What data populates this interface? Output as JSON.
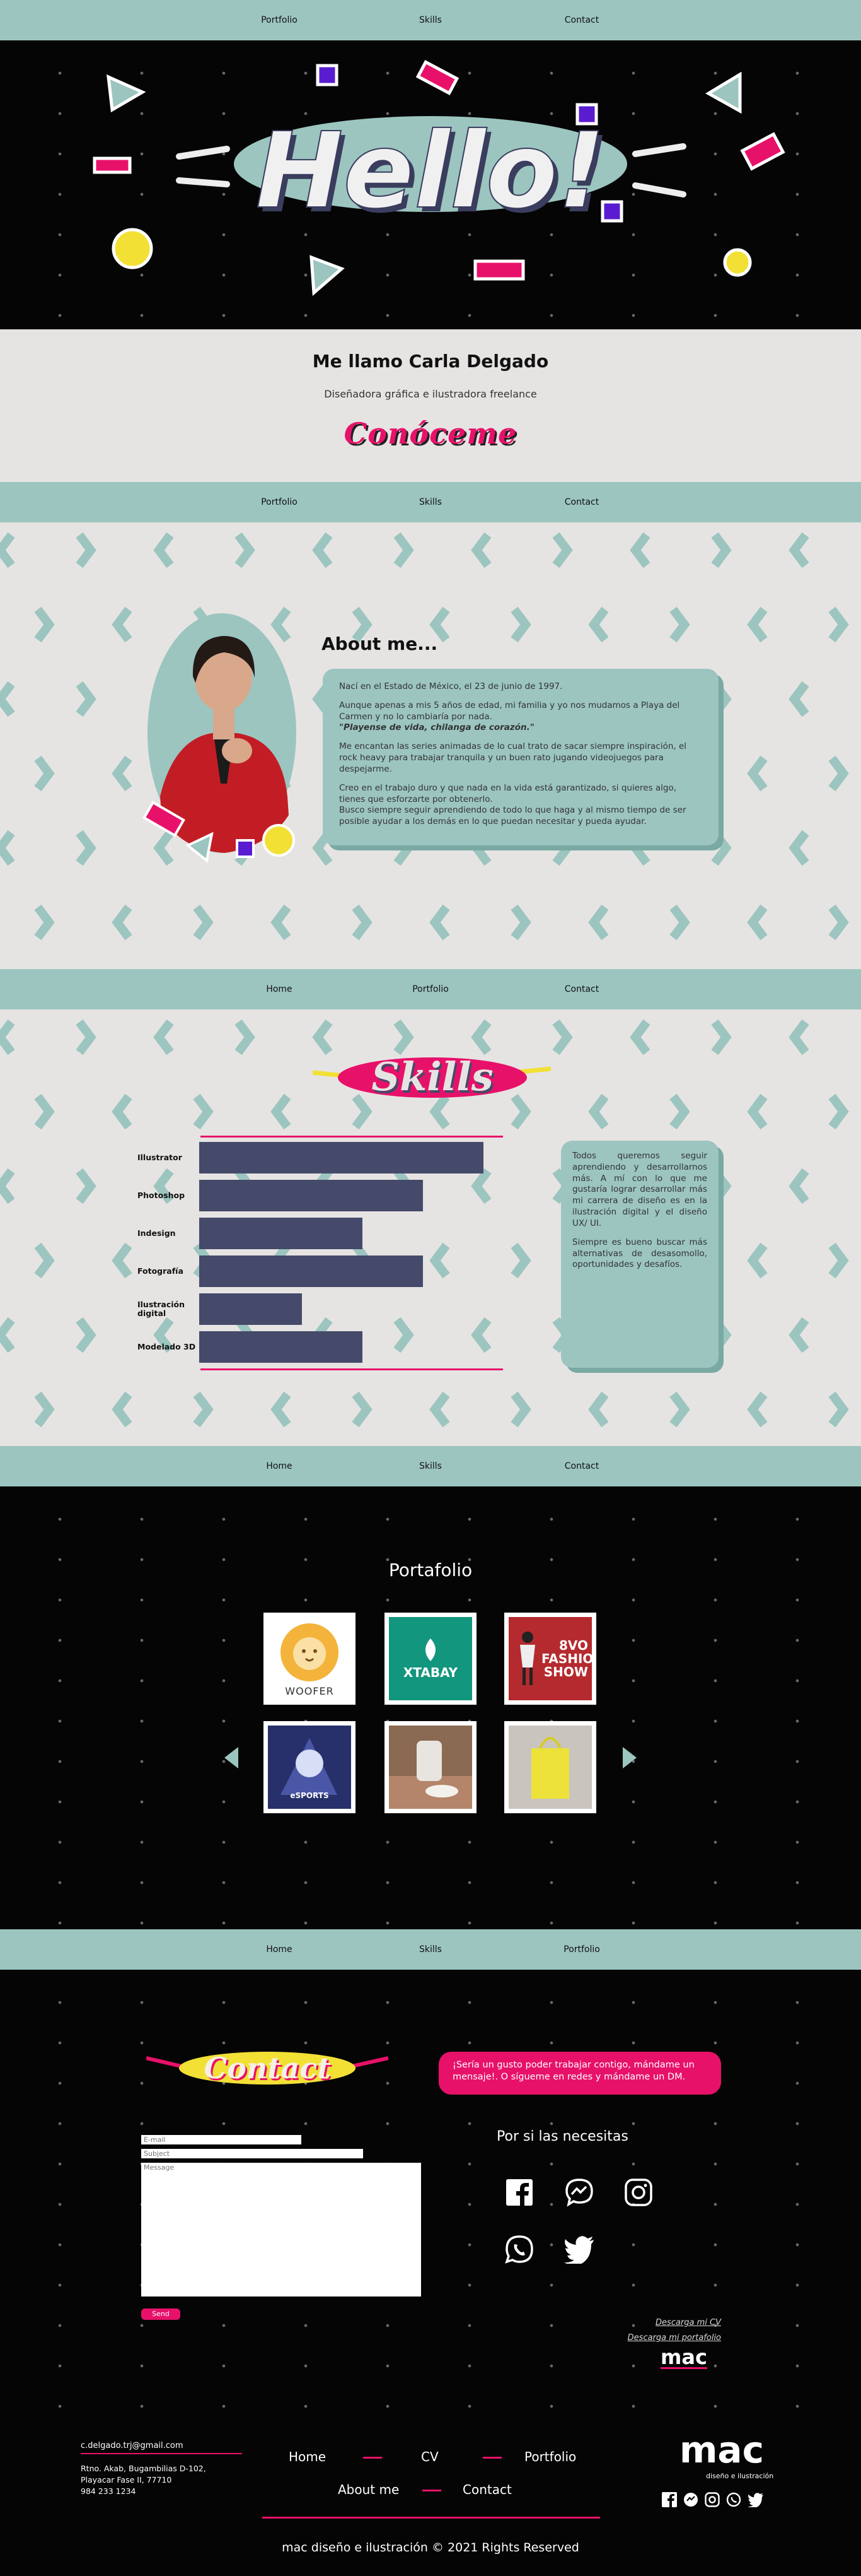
{
  "nav1": [
    "Portfolio",
    "Skills",
    "Contact"
  ],
  "hero": {
    "headline": "Hello!"
  },
  "intro": {
    "name": "Me llamo Carla Delgado",
    "role": "Diseñadora gráfica e ilustradora freelance",
    "cta": "Conóceme"
  },
  "nav2": [
    "Portfolio",
    "Skills",
    "Contact"
  ],
  "about": {
    "title": "About me...",
    "p1": "Nací en el Estado de México, el 23 de junio de 1997.",
    "p2": "Aunque apenas a mis 5 años de edad, mi familia y yo nos mudamos a Playa del Carmen y no lo cambiaría por nada.",
    "p2_quote": "\"Playense de vida, chilanga de corazón.\"",
    "p3": "Me encantan las series animadas de lo cual trato de sacar siempre inspiración, el rock heavy para trabajar tranquila y un buen rato jugando videojuegos para despejarme.",
    "p4": "Creo en el trabajo duro y que nada en la vida está garantizado, si quieres algo, tienes que esforzarte por obtenerlo.",
    "p5": "Busco siempre seguir aprendiendo de todo lo que haga y al mismo tiempo de ser posible ayudar a los demás en lo que puedan necesitar y pueda ayudar."
  },
  "nav3": [
    "Home",
    "Portfolio",
    "Contact"
  ],
  "skills": {
    "title": "Skills",
    "items": [
      {
        "label": "Illustrator",
        "level": 0.94
      },
      {
        "label": "Photoshop",
        "level": 0.74
      },
      {
        "label": "Indesign",
        "level": 0.54
      },
      {
        "label": "Fotografía",
        "level": 0.74
      },
      {
        "label": "Ilustración digital",
        "level": 0.34
      },
      {
        "label": "Modelado 3D",
        "level": 0.54
      }
    ],
    "text1": "Todos queremos seguir aprendiendo y desarrollarnos más. A mí con lo que me gustaría lograr desarrollar más mi carrera de diseño es en la ilustración digital y el diseño UX/ UI.",
    "text2": "Siempre es bueno buscar más alternativas de desasomollo, oportunidades y desafíos."
  },
  "nav4": [
    "Home",
    "Skills",
    "Contact"
  ],
  "portfolio": {
    "title": "Portafolio",
    "items": [
      {
        "name": "WOOFER",
        "bg": "#ffffff"
      },
      {
        "name": "XTABAY",
        "bg": "#12967e"
      },
      {
        "name": "8VO FASHION SHOW",
        "bg": "#b52a2e"
      },
      {
        "name": "eSPORTS",
        "bg": "#27306b"
      },
      {
        "name": "",
        "bg": "#8a6a52"
      },
      {
        "name": "",
        "bg": "#c9c4bd"
      }
    ]
  },
  "nav5": [
    "Home",
    "Skills",
    "Portfolio"
  ],
  "contact": {
    "title": "Contact",
    "bubble": "¡Sería un gusto poder trabajar contigo, mándame un mensaje!. O sígueme en redes y mándame un DM.",
    "email_placeholder": "E-mail",
    "subject_placeholder": "Subject",
    "message_placeholder": "Message",
    "send": "Send",
    "needs": "Por si las necesitas",
    "cv": "Descarga mi CV",
    "portfolio_dl": "Descarga mi portafolio",
    "logo": "mac"
  },
  "footer": {
    "email": "c.delgado.trj@gmail.com",
    "address1": "Rtno. Akab, Bugambilias D-102,",
    "address2": "Playacar Fase II, 77710",
    "phone": "984 233 1234",
    "links_row1": [
      "Home",
      "CV",
      "Portfolio"
    ],
    "links_row2": [
      "About me",
      "Contact"
    ],
    "logo": "mac",
    "tagline": "diseño e ilustración",
    "copyright": "mac diseño e ilustración © 2021 Rights Reserved"
  },
  "colors": {
    "teal": "#9cc5c0",
    "pink": "#e8116a",
    "purple": "#5a1cd1",
    "yellow": "#f2e035",
    "navy": "#454a6a",
    "bg_light": "#e6e4e2"
  }
}
